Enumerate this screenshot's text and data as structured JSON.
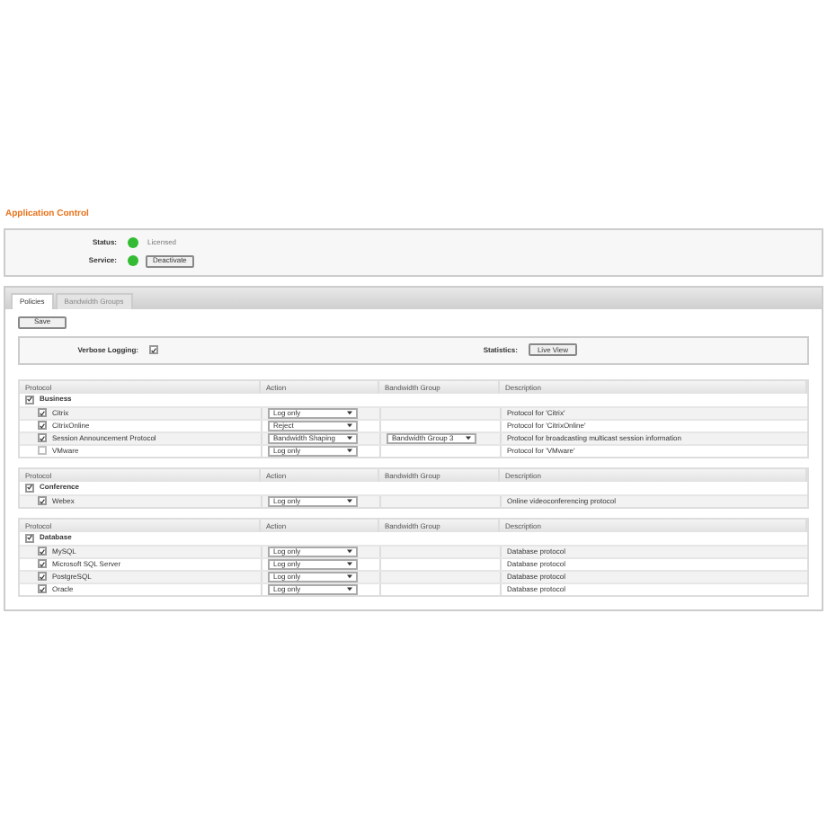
{
  "title": "Application Control",
  "status": {
    "status_label": "Status:",
    "status_value": "Licensed",
    "status_ok": true,
    "service_label": "Service:",
    "service_ok": true,
    "service_button": "Deactivate"
  },
  "tabs": [
    {
      "label": "Policies",
      "selected": true
    },
    {
      "label": "Bandwidth Groups",
      "selected": false
    }
  ],
  "save_button": "Save",
  "options": {
    "verbose_label": "Verbose Logging:",
    "verbose_checked": true,
    "statistics_label": "Statistics:",
    "statistics_button": "Live View"
  },
  "tables": [
    {
      "columns": [
        "Protocol",
        "Action",
        "Bandwidth Group",
        "Description"
      ],
      "group": {
        "name": "Business",
        "checked": true
      },
      "rows": [
        {
          "protocol": "Citrix",
          "checked": true,
          "action": "Log only",
          "bandwidth_group": "",
          "description": "Protocol for 'Citrix'"
        },
        {
          "protocol": "CitrixOnline",
          "checked": true,
          "action": "Reject",
          "bandwidth_group": "",
          "description": "Protocol for 'CitrixOnline'"
        },
        {
          "protocol": "Session Announcement Protocol",
          "checked": true,
          "action": "Bandwidth Shaping",
          "bandwidth_group": "Bandwidth Group 3",
          "description": "Protocol for broadcasting multicast session information"
        },
        {
          "protocol": "VMware",
          "checked": false,
          "action": "Log only",
          "bandwidth_group": "",
          "description": "Protocol for 'VMware'"
        }
      ]
    },
    {
      "columns": [
        "Protocol",
        "Action",
        "Bandwidth Group",
        "Description"
      ],
      "group": {
        "name": "Conference",
        "checked": true
      },
      "rows": [
        {
          "protocol": "Webex",
          "checked": true,
          "action": "Log only",
          "bandwidth_group": "",
          "description": "Online videoconferencing protocol"
        }
      ]
    },
    {
      "columns": [
        "Protocol",
        "Action",
        "Bandwidth Group",
        "Description"
      ],
      "group": {
        "name": "Database",
        "checked": true
      },
      "rows": [
        {
          "protocol": "MySQL",
          "checked": true,
          "action": "Log only",
          "bandwidth_group": "",
          "description": "Database protocol"
        },
        {
          "protocol": "Microsoft SQL Server",
          "checked": true,
          "action": "Log only",
          "bandwidth_group": "",
          "description": "Database protocol"
        },
        {
          "protocol": "PostgreSQL",
          "checked": true,
          "action": "Log only",
          "bandwidth_group": "",
          "description": "Database protocol"
        },
        {
          "protocol": "Oracle",
          "checked": true,
          "action": "Log only",
          "bandwidth_group": "",
          "description": "Database protocol"
        }
      ]
    }
  ]
}
